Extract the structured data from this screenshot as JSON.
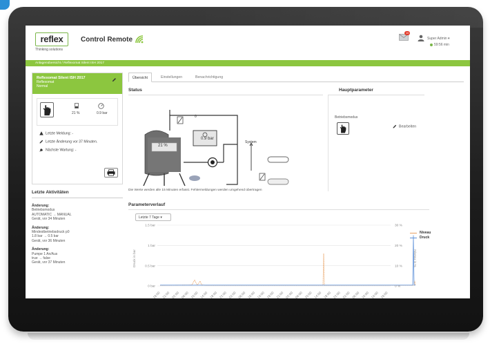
{
  "header": {
    "logo_text": "reflex",
    "tagline": "Thinking solutions",
    "app_title": "Control Remote",
    "mail_badge": "10",
    "user_name": "Super Admin ▾",
    "session_timer": "59:56 min"
  },
  "breadcrumb": "Anlagenübersicht  /  Reflexomat Silent ISH 2017",
  "device": {
    "name": "Reflexomat Silent ISH 2017",
    "type": "Reflexomat",
    "state": "Normal",
    "level_value": "21 %",
    "pressure_value": "0.9 bar",
    "info": [
      {
        "icon": "warning-icon",
        "text": "Letzte Meldung: -"
      },
      {
        "icon": "pencil-icon",
        "text": "Letzte Änderung vor 37 Minuten."
      },
      {
        "icon": "wrench-icon",
        "text": "Nächste Wartung: -"
      }
    ]
  },
  "activities": {
    "title": "Letzte Aktivitäten",
    "items": [
      {
        "title": "Änderung:",
        "lines": [
          "Betriebsmodus",
          "AUTOMATIC → MANUAL",
          "Gerät, vor 34 Minuten"
        ]
      },
      {
        "title": "Änderung:",
        "lines": [
          "Mindestbetriebsdruck p0",
          "1.8 bar → 0.5 bar",
          "Gerät, vor 36 Minuten"
        ]
      },
      {
        "title": "Änderung:",
        "lines": [
          "Pumpe 1 An/Aus",
          "true → false",
          "Gerät, vor 37 Minuten"
        ]
      }
    ]
  },
  "tabs": [
    {
      "label": "Übersicht",
      "active": true
    },
    {
      "label": "Einstellungen",
      "active": false
    },
    {
      "label": "Benachrichtigung",
      "active": false
    }
  ],
  "status": {
    "title": "Status",
    "tank_level": "21 %",
    "pressure": "0.9 bar",
    "valve_value": "0",
    "system_label": "System",
    "note": "Die Werte werden alle 15 Minuten erfasst. Fehlermeldungen werden umgehend übertragen"
  },
  "main_params": {
    "title": "Hauptparameter",
    "mode_label": "Betriebsmodus",
    "edit_label": "Bearbeiten"
  },
  "parameter_history": {
    "title": "Parameterverlauf",
    "range_label": "Letzte 7 Tage  ▾"
  },
  "chart_data": {
    "type": "line",
    "ylabel_left": "Druck in bar",
    "ylabel_right": "Niveau in %",
    "y_left_ticks": [
      "1.5 bar",
      "1 bar",
      "0.5 bar",
      "0 bar"
    ],
    "y_right_ticks": [
      "30 %",
      "20 %",
      "10 %",
      "0 %"
    ],
    "ylim_left": [
      0,
      1.5
    ],
    "ylim_right": [
      0,
      30
    ],
    "x_ticks": [
      "18:00",
      "22:00",
      "02:00",
      "06:00",
      "10:00",
      "14:00",
      "18:00",
      "22:00",
      "02:00",
      "06:00",
      "10:00",
      "14:00",
      "18:00",
      "22:00",
      "02:00",
      "06:00",
      "10:00",
      "14:00",
      "18:00",
      "22:00",
      "02:00",
      "06:00",
      "10:00",
      "14:00",
      "18:00"
    ],
    "series": [
      {
        "name": "Niveau",
        "color": "#e8a060",
        "axis": "right"
      },
      {
        "name": "Druck",
        "color": "#5b8fd8",
        "axis": "left"
      }
    ],
    "grid": true,
    "legend_position": "top-right"
  },
  "colors": {
    "brand_green": "#8cc63f",
    "niveau_orange": "#e8a060",
    "druck_blue": "#5b8fd8"
  }
}
